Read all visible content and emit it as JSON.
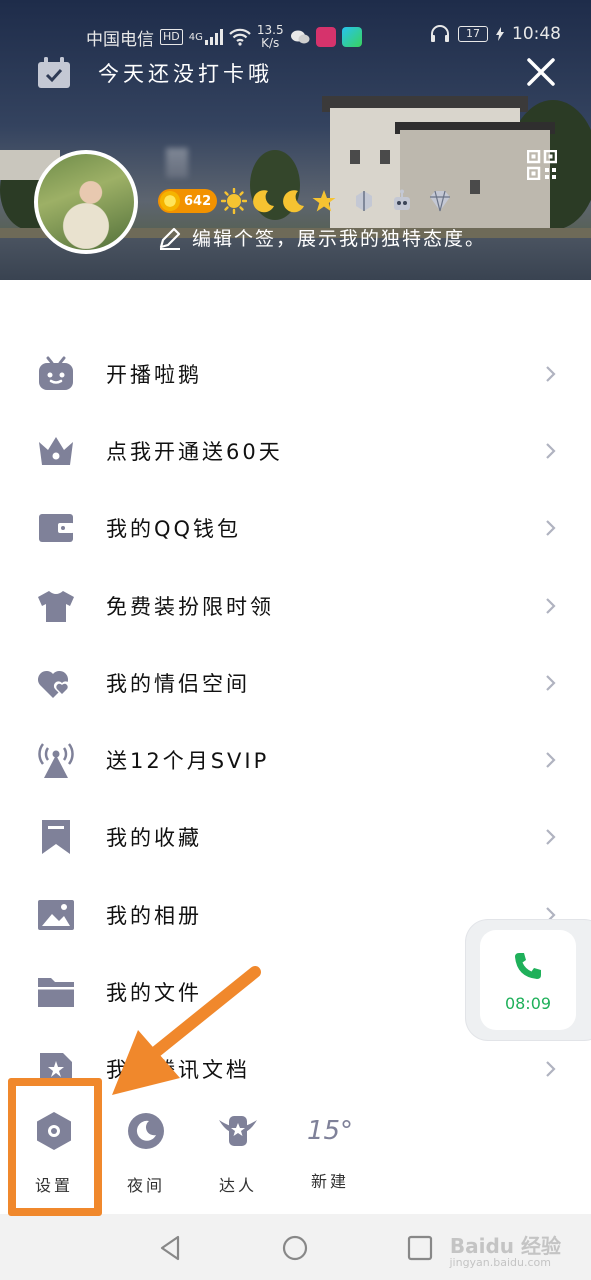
{
  "status_bar": {
    "carrier": "中国电信",
    "hd": "HD",
    "signal_gen": "4G",
    "speed_value": "13.5",
    "speed_unit": "K/s",
    "battery": "17",
    "time": "10:48"
  },
  "header": {
    "checkin_text": "今天还没打卡哦",
    "coin_count": "642",
    "signature": "编辑个签，展示我的独特态度。"
  },
  "menu": {
    "items": [
      {
        "label": "开播啦鹅",
        "icon": "tv-mascot-icon"
      },
      {
        "label": "点我开通送60天",
        "icon": "crown-icon"
      },
      {
        "label": "我的QQ钱包",
        "icon": "wallet-icon"
      },
      {
        "label": "免费装扮限时领",
        "icon": "shirt-icon"
      },
      {
        "label": "我的情侣空间",
        "icon": "hearts-icon"
      },
      {
        "label": "送12个月SVIP",
        "icon": "broadcast-tower-icon"
      },
      {
        "label": "我的收藏",
        "icon": "bookmark-icon"
      },
      {
        "label": "我的相册",
        "icon": "photo-icon"
      },
      {
        "label": "我的文件",
        "icon": "folder-icon"
      },
      {
        "label": "我的腾讯文档",
        "icon": "document-icon"
      }
    ]
  },
  "call_widget": {
    "duration": "08:09",
    "accent": "#1fb05a"
  },
  "shortcuts": {
    "settings": "设置",
    "night": "夜间",
    "expert": "达人",
    "weather_temp": "15°",
    "weather_label": "新建"
  },
  "watermark": {
    "brand": "Baidu 经验",
    "sub": "jingyan.baidu.com"
  },
  "colors": {
    "icon_gray": "#7f8199",
    "annotation_orange": "#f0882c"
  }
}
